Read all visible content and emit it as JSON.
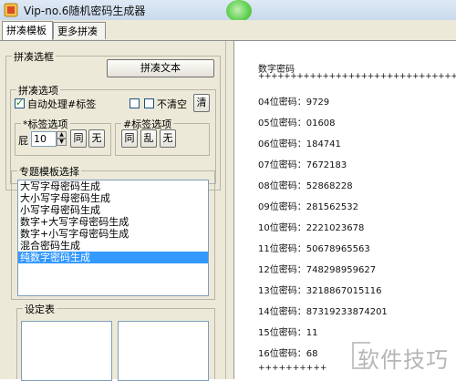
{
  "window": {
    "title": "Vip-no.6随机密码生成器"
  },
  "tabs": [
    {
      "label": "拼凑模板"
    },
    {
      "label": "更多拼凑"
    }
  ],
  "settings": {
    "group_title": "拼凑选框",
    "generate_button": "拼凑文本",
    "options": {
      "title": "拼凑选项",
      "auto_process_label": "自动处理#标签",
      "auto_process_checked": true,
      "checkbox_a_label": "",
      "checkbox_b_label": "不清空",
      "clear_button": "清"
    },
    "tag_options_left": {
      "title": "*标签选项",
      "prefix": "屁",
      "value": "10",
      "same_button": "同",
      "none_button": "无"
    },
    "tag_options_right": {
      "title": "#标签选项",
      "same_button": "同",
      "random_button": "乱",
      "none_button": "无"
    }
  },
  "templates": {
    "title": "专题模板选择",
    "items": [
      "大写字母密码生成",
      "大小写字母密码生成",
      "小写字母密码生成",
      "数字+大写字母密码生成",
      "数字+小写字母密码生成",
      "混合密码生成",
      "纯数字密码生成"
    ],
    "selected_index": 6
  },
  "config": {
    "title": "设定表"
  },
  "output": {
    "header": "数字密码",
    "separator": "+++++++++++++++++++++++++++++++++",
    "lines": [
      "04位密码：9729",
      "05位密码：01608",
      "06位密码：184741",
      "07位密码：7672183",
      "08位密码：52868228",
      "09位密码：281562532",
      "10位密码：2221023678",
      "11位密码：50678965563",
      "12位密码：748298959627",
      "13位密码：3218867015116",
      "14位密码：87319233874201",
      "15位密码：11",
      "16位密码：68"
    ],
    "footer": "++++++++++"
  },
  "watermark": {
    "text": "软件技巧"
  }
}
